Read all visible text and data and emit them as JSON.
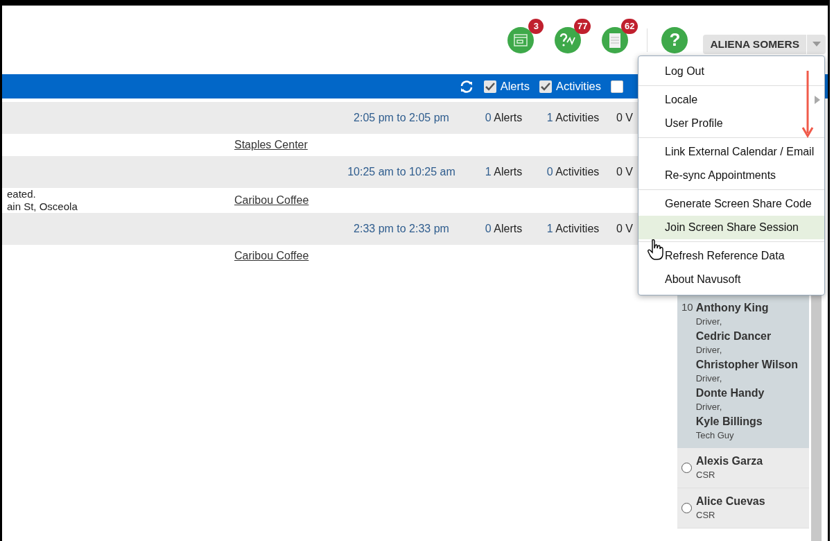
{
  "header": {
    "notifications": [
      {
        "kind": "calendar",
        "count": "3"
      },
      {
        "kind": "question-wave",
        "count": "77"
      },
      {
        "kind": "document",
        "count": "62"
      }
    ],
    "help": {
      "glyph": "?"
    },
    "user_button": {
      "label": "ALIENA SOMERS"
    }
  },
  "toolbar": {
    "filters": [
      {
        "label": "Alerts",
        "checked": true
      },
      {
        "label": "Activities",
        "checked": true
      },
      {
        "checked": false
      }
    ]
  },
  "appointments": [
    {
      "time": "2:05 pm to 2:05 pm",
      "alerts": {
        "count": "0",
        "label": "Alerts"
      },
      "activities": {
        "count": "1",
        "label": "Activities"
      },
      "column_6": "0 V",
      "location": "Staples Center"
    },
    {
      "time": "10:25 am to 10:25 am",
      "alerts": {
        "count": "1",
        "label": "Alerts"
      },
      "activities": {
        "count": "0",
        "label": "Activities"
      },
      "column_6": "0 V",
      "location": "Caribou Coffee",
      "notes": [
        "eated.",
        "ain St, Osceola"
      ]
    },
    {
      "time": "2:33 pm to 2:33 pm",
      "alerts": {
        "count": "0",
        "label": "Alerts"
      },
      "activities": {
        "count": "1",
        "label": "Activities"
      },
      "column_6": "0 V",
      "location": "Caribou Coffee"
    }
  ],
  "user_menu": {
    "groups": [
      [
        {
          "label": "Log Out",
          "highlighted": false
        }
      ],
      [
        {
          "label": "Locale",
          "submenu": true,
          "highlighted": false
        },
        {
          "label": "User Profile",
          "highlighted": false
        }
      ],
      [
        {
          "label": "Link External Calendar / Email",
          "highlighted": false
        },
        {
          "label": "Re-sync Appointments",
          "highlighted": false
        }
      ],
      [
        {
          "label": "Generate Screen Share Code",
          "highlighted": false
        },
        {
          "label": "Join Screen Share Session",
          "highlighted": true
        }
      ],
      [
        {
          "label": "Refresh Reference Data",
          "highlighted": false
        },
        {
          "label": "About Navusoft",
          "highlighted": false
        }
      ]
    ]
  },
  "people_panel": {
    "items": [
      {
        "kind": "group",
        "count": "10",
        "selected": true,
        "members": [
          {
            "name": "Anthony King",
            "role": "Driver,"
          },
          {
            "name": "Cedric Dancer",
            "role": "Driver,"
          },
          {
            "name": "Christopher Wilson",
            "role": "Driver,"
          },
          {
            "name": "Donte Handy",
            "role": "Driver,"
          },
          {
            "name": "Kyle Billings",
            "role": "Tech Guy"
          }
        ]
      },
      {
        "kind": "person",
        "selected": false,
        "name": "Alexis Garza",
        "role": "CSR"
      },
      {
        "kind": "person",
        "selected": false,
        "name": "Alice Cuevas",
        "role": "CSR"
      }
    ]
  }
}
